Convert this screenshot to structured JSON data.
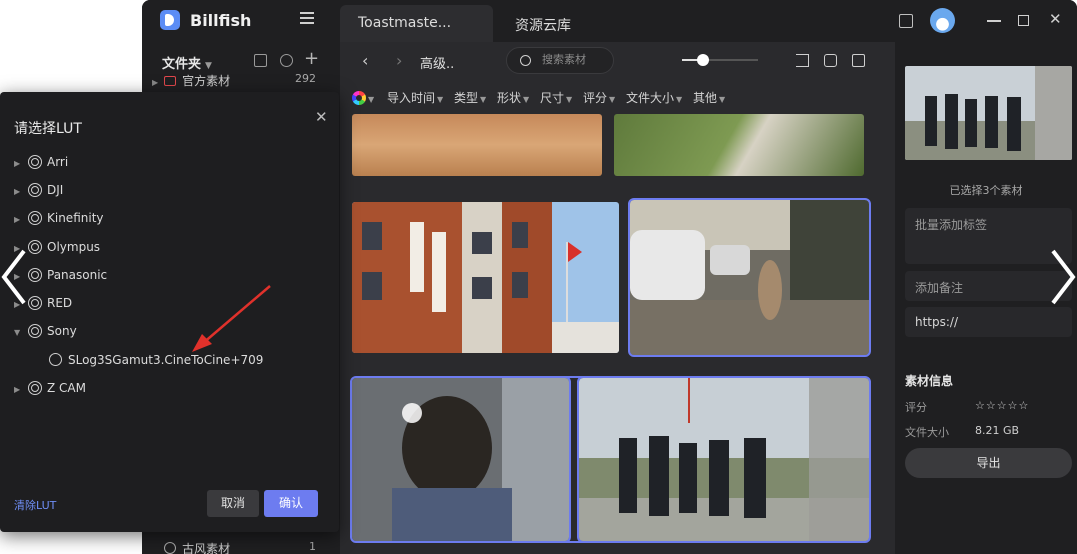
{
  "app": {
    "brand": "Billfish"
  },
  "tabs": [
    {
      "label": "Toastmaste..."
    },
    {
      "label": "资源云库"
    }
  ],
  "sidebar": {
    "header": "文件夹",
    "items": [
      {
        "label": "官方素材",
        "count": "292"
      },
      {
        "label": "古风素材",
        "count": "1"
      }
    ]
  },
  "toolbar": {
    "breadcrumb": "高级..",
    "search_placeholder": "搜索素材",
    "zoom_level": 0.28,
    "filters": [
      "导入时间",
      "类型",
      "形状",
      "尺寸",
      "评分",
      "文件大小",
      "其他"
    ]
  },
  "right_panel": {
    "selected_text": "已选择3个素材",
    "tags_placeholder": "批量添加标签",
    "note_placeholder": "添加备注",
    "url_value": "https://",
    "info_title": "素材信息",
    "rating_label": "评分",
    "rating_value": "☆☆☆☆☆",
    "size_label": "文件大小",
    "size_value": "8.21 GB",
    "export_label": "导出"
  },
  "lut_dialog": {
    "title": "请选择LUT",
    "vendors": [
      "Arri",
      "DJI",
      "Kinefinity",
      "Olympus",
      "Panasonic",
      "RED",
      "Sony",
      "Z CAM"
    ],
    "expanded_vendor": "Sony",
    "sony_luts": [
      "SLog3SGamut3.CineToCine+709"
    ],
    "clear_label": "清除LUT",
    "cancel_label": "取消",
    "confirm_label": "确认"
  },
  "colors": {
    "accent": "#6d7cf0",
    "clear_link": "#6f8ef5",
    "brand_logo": "#5b8cf5"
  }
}
